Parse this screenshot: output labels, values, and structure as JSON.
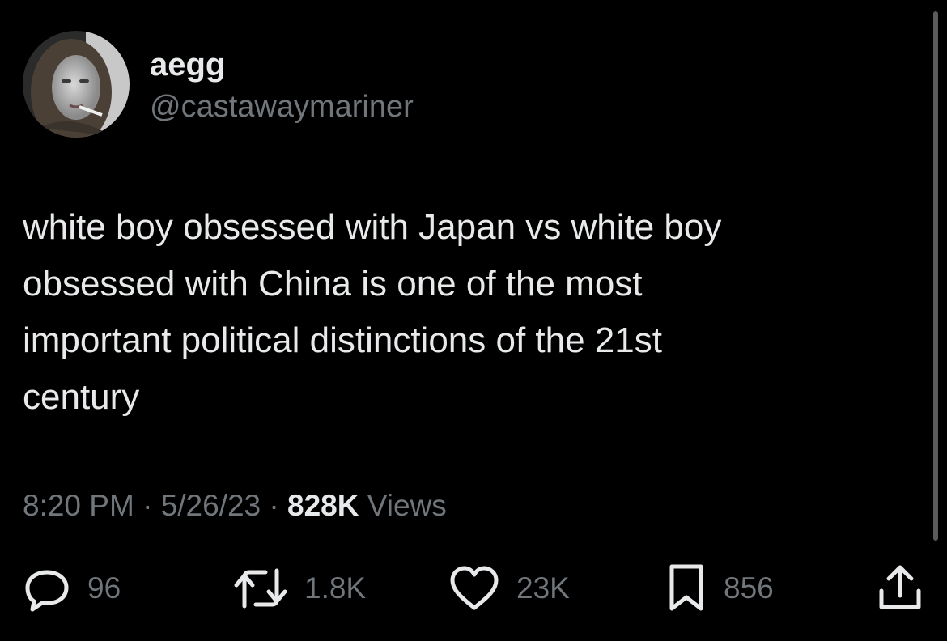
{
  "author": {
    "display_name": "aegg",
    "handle": "@castawaymariner"
  },
  "tweet": {
    "text_lines": [
      "white boy obsessed with Japan vs white boy",
      "obsessed with China is one of the most",
      "important political distinctions of the 21st",
      "century"
    ],
    "time": "8:20 PM",
    "date": "5/26/23",
    "separator": "·",
    "views_count": "828K",
    "views_label": "Views"
  },
  "actions": {
    "replies": "96",
    "retweets": "1.8K",
    "likes": "23K",
    "bookmarks": "856"
  },
  "icons": {
    "reply": "speech-bubble-icon",
    "retweet": "retweet-arrows-icon",
    "like": "heart-icon",
    "bookmark": "bookmark-icon",
    "share": "share-upload-icon"
  },
  "colors": {
    "background": "#000000",
    "primary_text": "#e7e9ea",
    "secondary_text": "#71767b"
  }
}
